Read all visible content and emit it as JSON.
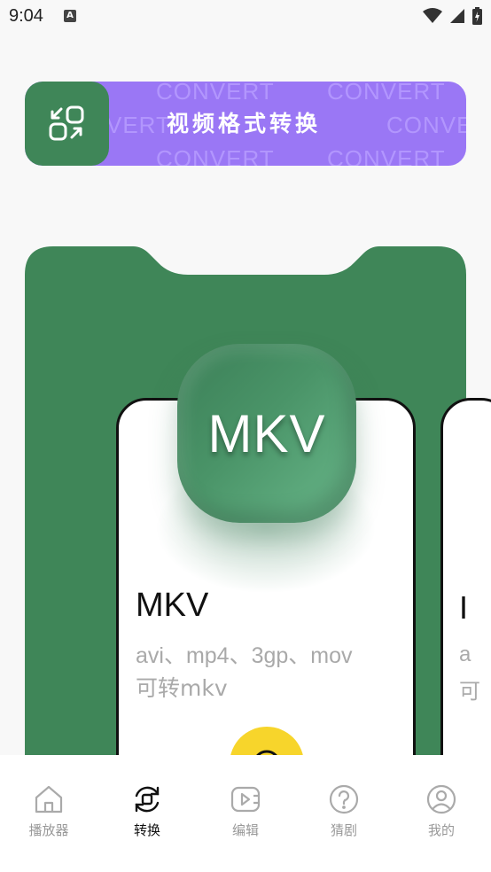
{
  "status_bar": {
    "time": "9:04",
    "notification_letter": "A"
  },
  "banner": {
    "title": "视频格式转换",
    "bg_words": [
      "CONVERT",
      "CONVERT",
      "VERT",
      "CONVERT",
      "CONVERT",
      "CONVERT"
    ],
    "icon": "convert-arrows-icon",
    "bg_color": "#9a77f5",
    "icon_box_color": "#3f8658"
  },
  "panel": {
    "color": "#3f8658"
  },
  "card": {
    "badge_label": "MKV",
    "title": "MKV",
    "desc_line1": "avi、mp4、3gp、mov",
    "desc_line2": "可转mkv",
    "action_color": "#f7d52b"
  },
  "next_card": {
    "title_fragment": "I",
    "desc1_fragment": "a",
    "desc2_fragment": "可"
  },
  "tabs": [
    {
      "label": "播放器",
      "icon": "home-icon",
      "active": false
    },
    {
      "label": "转换",
      "icon": "convert-cycle-icon",
      "active": true
    },
    {
      "label": "编辑",
      "icon": "video-edit-icon",
      "active": false
    },
    {
      "label": "猜剧",
      "icon": "question-icon",
      "active": false
    },
    {
      "label": "我的",
      "icon": "user-icon",
      "active": false
    }
  ]
}
